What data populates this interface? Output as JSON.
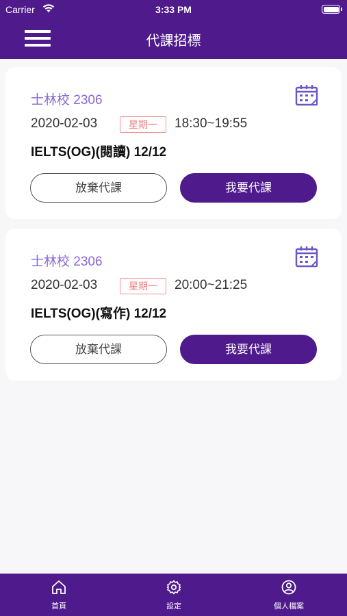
{
  "status_bar": {
    "carrier": "Carrier",
    "time": "3:33 PM"
  },
  "nav": {
    "title": "代課招標",
    "menu_icon": "hamburger-menu-icon"
  },
  "cards": [
    {
      "school": "士林校 2306",
      "date": "2020-02-03",
      "weekday": "星期一",
      "time": "18:30~19:55",
      "course": "IELTS(OG)(閱讀) 12/12",
      "give_up_label": "放棄代課",
      "take_label": "我要代課",
      "icon": "calendar-icon"
    },
    {
      "school": "士林校 2306",
      "date": "2020-02-03",
      "weekday": "星期一",
      "time": "20:00~21:25",
      "course": "IELTS(OG)(寫作) 12/12",
      "give_up_label": "放棄代課",
      "take_label": "我要代課",
      "icon": "calendar-icon"
    }
  ],
  "tab_bar": {
    "items": [
      {
        "label": "首頁",
        "icon": "home-icon"
      },
      {
        "label": "設定",
        "icon": "gear-icon"
      },
      {
        "label": "個人檔案",
        "icon": "user-profile-icon"
      }
    ]
  },
  "colors": {
    "primary": "#4e1a8c",
    "school_text": "#8a67d9",
    "weekday_badge": "#ee7c7c",
    "background": "#f7f7fa"
  }
}
